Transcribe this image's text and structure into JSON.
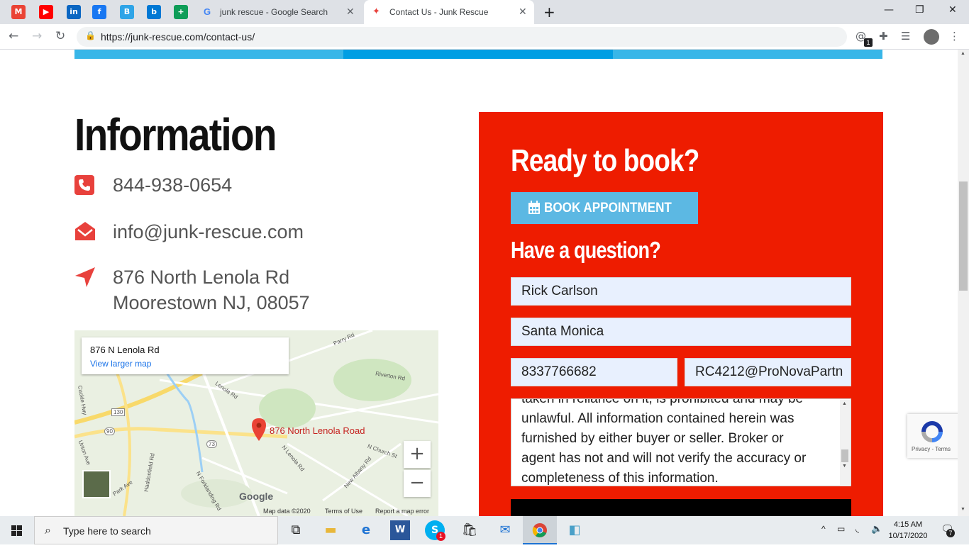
{
  "browser": {
    "bookmarks": [
      {
        "icon": "gmail-icon",
        "glyph": "M",
        "color": "#ea4335"
      },
      {
        "icon": "youtube-icon",
        "glyph": "▶",
        "color": "#ff0000"
      },
      {
        "icon": "linkedin-icon",
        "glyph": "in",
        "color": "#0a66c2"
      },
      {
        "icon": "facebook-icon",
        "glyph": "f",
        "color": "#1877f2"
      },
      {
        "icon": "bookmark-b-icon",
        "glyph": "B",
        "color": "#2fa4e7"
      },
      {
        "icon": "bing-icon",
        "glyph": "b",
        "color": "#0078d4"
      },
      {
        "icon": "plus-app-icon",
        "glyph": "+",
        "color": "#0f9d58"
      }
    ],
    "tabs": [
      {
        "title": "junk rescue - Google Search",
        "active": false
      },
      {
        "title": "Contact Us - Junk Rescue",
        "active": true
      }
    ],
    "url": "https://junk-rescue.com/contact-us/",
    "extension_badge": "1"
  },
  "info": {
    "title": "Information",
    "phone": "844-938-0654",
    "email": "info@junk-rescue.com",
    "address_line1": "876 North Lenola Rd",
    "address_line2": "Moorestown NJ, 08057"
  },
  "map": {
    "card_address": "876 N Lenola Rd",
    "card_link": "View larger map",
    "pin_label": "876 North Lenola Road",
    "zoom_in": "+",
    "zoom_out": "−",
    "google": "Google",
    "map_data": "Map data ©2020",
    "terms": "Terms of Use",
    "report": "Report a map error",
    "roads": [
      "Parry Rd",
      "Lenola Rd",
      "Riverton Rd",
      "130",
      "90",
      "73",
      "N Church St",
      "N Lenola Rd",
      "New Albany Rd",
      "Haddonfield Rd",
      "N Forklanding Rd",
      "Park Ave",
      "Union Ave",
      "Cuckle Hwy"
    ]
  },
  "form": {
    "ready_title": "Ready to book?",
    "book_button": "BOOK APPOINTMENT",
    "question_title": "Have a question?",
    "name_value": "Rick Carlson",
    "city_value": "Santa Monica",
    "phone_value": "8337766682",
    "email_value": "RC4212@ProNovaPartn",
    "message_lines": [
      "taken in reliance on it, is prohibited and may be",
      "unlawful.  All information contained herein was",
      "furnished by either buyer or seller.  Broker or",
      "agent has not and will not verify the accuracy or",
      "completeness of this information."
    ]
  },
  "recaptcha": {
    "terms": "Privacy - Terms"
  },
  "taskbar": {
    "search_placeholder": "Type here to search",
    "time": "4:15 AM",
    "date": "10/17/2020",
    "notification_count": "7",
    "skype_badge": "1"
  },
  "colors": {
    "brand_red": "#ee1c00",
    "book_blue": "#5cb8e3",
    "top_bar_light": "#38b6e8",
    "top_bar_dark": "#009ee3",
    "icon_red": "#e8413c"
  }
}
